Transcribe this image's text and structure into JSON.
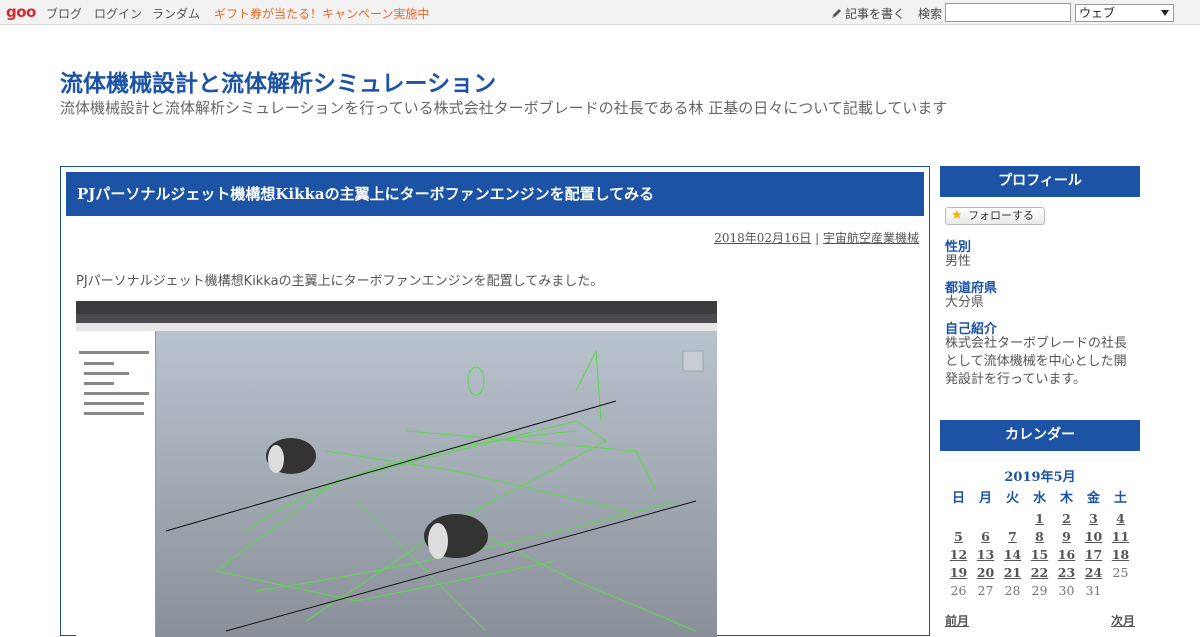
{
  "topbar": {
    "logo": "goo",
    "nav": [
      "ブログ",
      "ログイン",
      "ランダム"
    ],
    "promo": "ギフト券が当たる！キャンペーン実施中",
    "write": "記事を書く",
    "search_label": "検索",
    "search_value": "",
    "search_scope": "ウェブ"
  },
  "header": {
    "title": "流体機械設計と流体解析シミュレーション",
    "description": "流体機械設計と流体解析シミュレーションを行っている株式会社ターボブレードの社長である林 正基の日々について記載しています"
  },
  "article": {
    "title": "PJパーソナルジェット機構想Kikkaの主翼上にターボファンエンジンを配置してみる",
    "date": "2018年02月16日",
    "separator": "|",
    "category": "宇宙航空産業機械",
    "lead": "PJパーソナルジェット機構想Kikkaの主翼上にターボファンエンジンを配置してみました。"
  },
  "sidebar": {
    "profile_heading": "プロフィール",
    "follow_button": "フォローする",
    "fields": [
      {
        "label": "性別",
        "value": "男性"
      },
      {
        "label": "都道府県",
        "value": "大分県"
      },
      {
        "label": "自己紹介",
        "value": "株式会社ターボブレードの社長として流体機械を中心とした開発設計を行っています。"
      }
    ],
    "calendar_heading": "カレンダー",
    "calendar": {
      "month": "2019年5月",
      "weekdays": [
        "日",
        "月",
        "火",
        "水",
        "木",
        "金",
        "土"
      ],
      "weeks": [
        [
          "",
          "",
          "",
          "1",
          "2",
          "3",
          "4"
        ],
        [
          "5",
          "6",
          "7",
          "8",
          "9",
          "10",
          "11"
        ],
        [
          "12",
          "13",
          "14",
          "15",
          "16",
          "17",
          "18"
        ],
        [
          "19",
          "20",
          "21",
          "22",
          "23",
          "24",
          "25"
        ],
        [
          "26",
          "27",
          "28",
          "29",
          "30",
          "31",
          ""
        ]
      ],
      "linked_max": 24,
      "prev": "前月",
      "next": "次月"
    }
  },
  "colors": {
    "accent": "#1c53a4",
    "logo": "#d8282d",
    "promo": "#e4682a",
    "wireframe": "#5bd94a"
  }
}
